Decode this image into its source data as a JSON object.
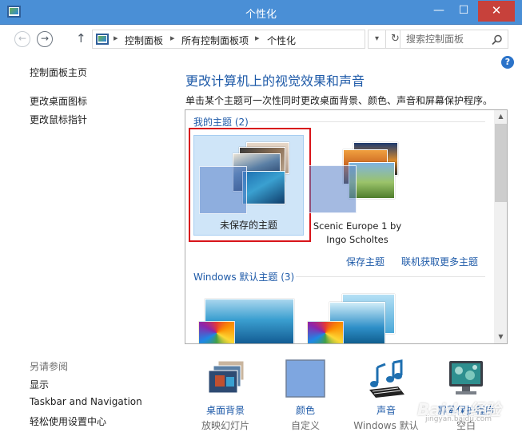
{
  "window": {
    "title": "个性化",
    "min_glyph": "—",
    "max_glyph": "☐",
    "close_glyph": "✕"
  },
  "address": {
    "back_glyph": "←",
    "forward_glyph": "→",
    "up_glyph": "↑",
    "breadcrumb": [
      "控制面板",
      "所有控制面板项",
      "个性化"
    ],
    "separator": "▸",
    "dropdown_glyph": "▾",
    "refresh_glyph": "↻"
  },
  "search": {
    "placeholder": "搜索控制面板"
  },
  "help": {
    "glyph": "?"
  },
  "sidebar": {
    "home_link": "控制面板主页",
    "links": [
      "更改桌面图标",
      "更改鼠标指针"
    ],
    "see_also_heading": "另请参阅",
    "see_also": [
      "显示",
      "Taskbar and Navigation",
      "轻松使用设置中心"
    ]
  },
  "main": {
    "title": "更改计算机上的视觉效果和声音",
    "description": "单击某个主题可一次性同时更改桌面背景、颜色、声音和屏幕保护程序。"
  },
  "themes": {
    "my_themes_label": "我的主题 (2)",
    "my_themes": [
      {
        "name": "未保存的主题",
        "selected": true
      },
      {
        "name": "Scenic Europe 1 by Ingo Scholtes",
        "selected": false
      }
    ],
    "save_theme_link": "保存主题",
    "get_more_link": "联机获取更多主题",
    "windows_default_label": "Windows 默认主题 (3)",
    "scroll_up_glyph": "▲",
    "scroll_down_glyph": "▼"
  },
  "bottom": [
    {
      "label": "桌面背景",
      "sub": "放映幻灯片"
    },
    {
      "label": "颜色",
      "sub": "自定义"
    },
    {
      "label": "声音",
      "sub": "Windows 默认"
    },
    {
      "label": "屏幕保护程序",
      "sub": "空白"
    }
  ],
  "watermark": {
    "text": "Baidu经验",
    "sub": "jingyan.baidu.com"
  },
  "colors": {
    "titlebar": "#4a8fd6",
    "link": "#1e5aa8",
    "selection_outline": "#d8141a",
    "selected_tile": "#cfe5f8"
  }
}
